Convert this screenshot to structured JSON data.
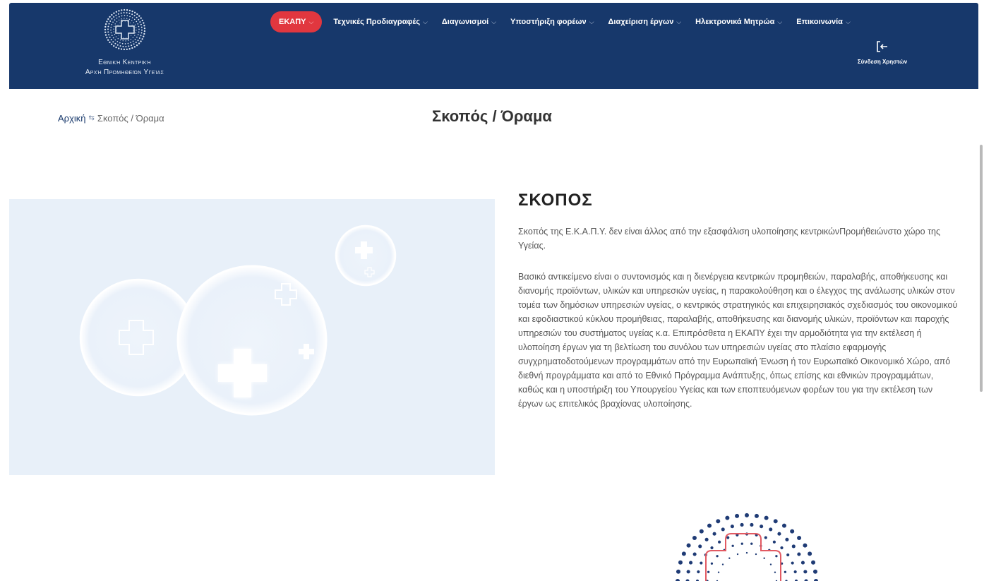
{
  "org": {
    "name_line1": "Εθνική Κεντρική",
    "name_line2": "Αρχή Προμηθειών Υγείας"
  },
  "nav": {
    "items": [
      {
        "label": "ΕΚΑΠΥ",
        "active": true
      },
      {
        "label": "Τεχνικές Προδιαγραφές"
      },
      {
        "label": "Διαγωνισμοί"
      },
      {
        "label": "Υποστήριξη φορέων"
      },
      {
        "label": "Διαχείριση έργων"
      },
      {
        "label": "Ηλεκτρονικά Μητρώα"
      },
      {
        "label": "Επικοινωνία"
      }
    ],
    "chevron": "⌵"
  },
  "login": {
    "label": "Σύνδεση Χρηστών",
    "icon": "login-arrow-icon"
  },
  "breadcrumb": {
    "home": "Αρχική",
    "separator": "⇆",
    "current": "Σκοπός / Όραμα"
  },
  "page_title": "Σκοπός / Όραμα",
  "section": {
    "heading": "ΣΚΟΠΟΣ",
    "paragraph1": "Σκοπός της Ε.Κ.Α.Π.Υ. δεν είναι άλλος από την εξασφάλιση υλοποίησης κεντρικώνΠρομήθειώνστο χώρο της Υγείας.",
    "paragraph2": "Βασικό αντικείμενο είναι ο συντονισμός και η διενέργεια κεντρικών προμηθειών, παραλαβής, αποθήκευσης και διανομής προϊόντων, υλικών και υπηρεσιών υγείας, η παρακολούθηση και ο έλεγχος της ανάλωσης υλικών στον τομέα των δημόσιων υπηρεσιών υγείας, ο κεντρικός στρατηγικός και επιχειρησιακός σχεδιασμός του οικονομικού και εφοδιαστικού κύκλου προμήθειας, παραλαβής, αποθήκευσης και διανομής υλικών, προϊόντων και παροχής υπηρεσιών του συστήματος υγείας κ.α. Επιπρόσθετα η ΕΚΑΠΥ έχει την αρμοδιότητα για την εκτέλεση ή υλοποίηση έργων για τη βελτίωση του συνόλου των υπηρεσιών υγείας στο πλαίσιο εφαρμογής συγχρηματοδοτούμενων προγραμμάτων από την Ευρωπαϊκή Ένωση ή τον Ευρωπαϊκό Οικονομικό Χώρο, από διεθνή προγράμματα και από το Εθνικό Πρόγραμμα Ανάπτυξης, όπως επίσης και εθνικών προγραμμάτων, καθώς και η υποστήριξη του Υπουργείου Υγείας και των εποπτευόμενων φορέων του για την εκτέλεση των έργων ως επιτελικός βραχίονας υλοποίησης."
  },
  "colors": {
    "header_bg": "#17386b",
    "active_pill": "#e1373f",
    "illustration_bg": "#e8f0f9",
    "logo_dots": "#1f3b75",
    "logo_cross": "#e25a62"
  }
}
